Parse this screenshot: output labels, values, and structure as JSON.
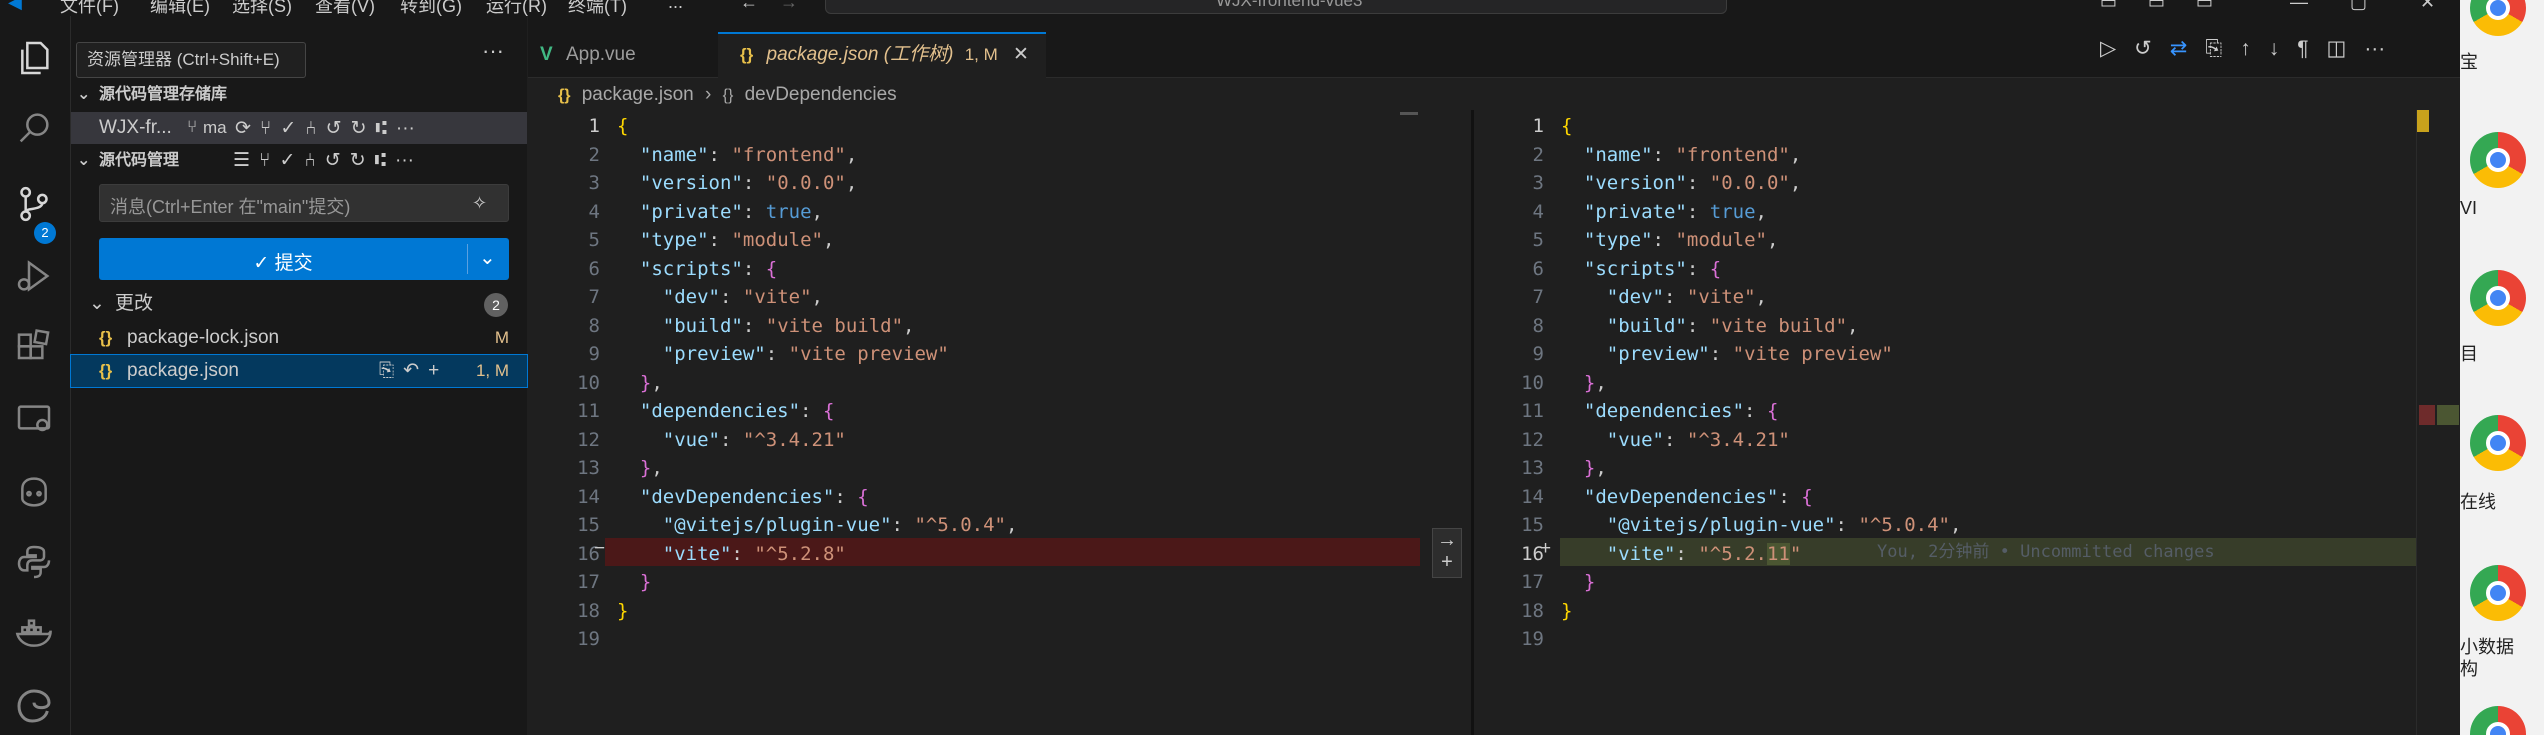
{
  "titlebar": {
    "menus": [
      "文件(F)",
      "编辑(E)",
      "选择(S)",
      "查看(V)",
      "转到(G)",
      "运行(R)",
      "终端(T)",
      "..."
    ],
    "search_text": "WJX-frontend-vue3"
  },
  "activity": {
    "scm_badge": "2"
  },
  "sidebar": {
    "tooltip": "资源管理器 (Ctrl+Shift+E)",
    "repos_title": "源代码管理存储库",
    "repo_name": "WJX-fr...",
    "repo_branch": "ma",
    "scm_title": "源代码管理",
    "message_placeholder": "消息(Ctrl+Enter 在\"main\"提交)",
    "commit_label": "✓ 提交",
    "changes_label": "更改",
    "changes_count": "2",
    "files": [
      {
        "name": "package-lock.json",
        "status": "M"
      },
      {
        "name": "package.json",
        "status": "1, M"
      }
    ]
  },
  "tabs": [
    {
      "label": "App.vue",
      "icon": "vue-icon"
    },
    {
      "label": "package.json (工作树)",
      "status": "1, M",
      "icon": "braces-icon"
    }
  ],
  "breadcrumb": {
    "file": "package.json",
    "sep": "›",
    "symbol": "devDependencies"
  },
  "diff": {
    "left_lines": [
      "{",
      "  \"name\": \"frontend\",",
      "  \"version\": \"0.0.0\",",
      "  \"private\": true,",
      "  \"type\": \"module\",",
      "  \"scripts\": {",
      "    \"dev\": \"vite\",",
      "    \"build\": \"vite build\",",
      "    \"preview\": \"vite preview\"",
      "  },",
      "  \"dependencies\": {",
      "    \"vue\": \"^3.4.21\"",
      "  },",
      "  \"devDependencies\": {",
      "    \"@vitejs/plugin-vue\": \"^5.0.4\",",
      "    \"vite\": \"^5.2.8\"",
      "  }",
      "}",
      ""
    ],
    "right_lines": [
      "{",
      "  \"name\": \"frontend\",",
      "  \"version\": \"0.0.0\",",
      "  \"private\": true,",
      "  \"type\": \"module\",",
      "  \"scripts\": {",
      "    \"dev\": \"vite\",",
      "    \"build\": \"vite build\",",
      "    \"preview\": \"vite preview\"",
      "  },",
      "  \"dependencies\": {",
      "    \"vue\": \"^3.4.21\"",
      "  },",
      "  \"devDependencies\": {",
      "    \"@vitejs/plugin-vue\": \"^5.0.4\",",
      "    \"vite\": \"^5.2.11\"",
      "  }",
      "}",
      ""
    ],
    "deleted_line": 16,
    "inserted_line": 16,
    "blame": "You, 2分钟前 • Uncommitted changes",
    "line_numbers": [
      "1",
      "2",
      "3",
      "4",
      "5",
      "6",
      "7",
      "8",
      "9",
      "10",
      "11",
      "12",
      "13",
      "14",
      "15",
      "16",
      "17",
      "18",
      "19"
    ]
  },
  "desktop": {
    "labels": [
      "宝",
      "VI",
      "目",
      "在线",
      "小数据\n构"
    ]
  },
  "colors": {
    "accent": "#0078d4",
    "deleted_bg": "#4b1818",
    "inserted_bg": "#373d29"
  }
}
